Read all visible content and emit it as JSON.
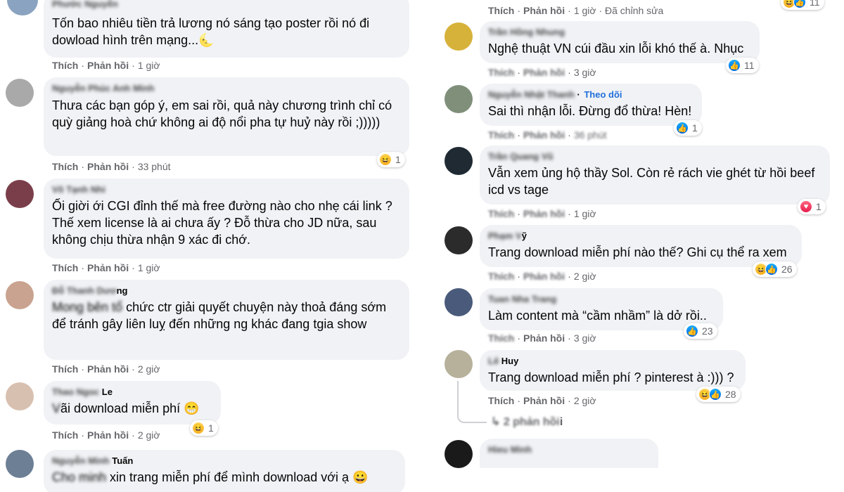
{
  "labels": {
    "like": "Thích",
    "reply": "Phản hồi"
  },
  "left": [
    {
      "id": "c1",
      "avatar_color": "#8aa3c0",
      "author_blur": "Phước Nguyễn",
      "author_clear": "",
      "text_blur": "",
      "text": "Tốn bao nhiêu tiền trả lương nó sáng tạo poster rồi nó đi dowload hình trên mạng...",
      "emoji": "🌜",
      "time": "1 giờ",
      "reaction": null
    },
    {
      "id": "c2",
      "avatar_color": "#a9a9a9",
      "author_blur": "Nguyễn Phúc Anh Minh",
      "author_clear": "",
      "text_blur": "",
      "text": "Thưa các bạn góp ý, em sai rồi, quả này chương trình chỉ có quỳ giảng hoà chứ không ai độ nổi pha tự huỷ này rồi ;)))))",
      "emoji": "",
      "time": "33 phút",
      "reaction": {
        "icons": [
          "haha"
        ],
        "count": "1"
      }
    },
    {
      "id": "c3",
      "avatar_color": "#7a3e4a",
      "author_blur": "Võ Tạnh Nhi",
      "author_clear": "",
      "text_blur": "",
      "text": "Ối giời ới CGI đỉnh thế mà free đường nào cho nhẹ cái link ? Thế xem license là ai chưa ấy ? Đỗ thừa cho JD nữa, sau không chịu thừa nhận 9 xác đi chớ.",
      "emoji": "",
      "time": "1 giờ",
      "reaction": null
    },
    {
      "id": "c4",
      "avatar_color": "#c9a38f",
      "author_blur": "Đỗ Thanh Dươ",
      "author_clear": "ng",
      "text_blur": "Mong bên tổ",
      "text": " chức ctr giải quyết chuyện này thoả đáng sớm để tránh gây liên luỵ đến những ng khác đang tgia show",
      "emoji": "",
      "time": "2 giờ",
      "reaction": null
    },
    {
      "id": "c5",
      "avatar_color": "#d8c0b0",
      "author_blur": "Thao Ngoc",
      "author_clear": " Le",
      "text_blur": "V",
      "text": "ãi download miễn phí",
      "emoji": "😁",
      "time": "2 giờ",
      "reaction": {
        "icons": [
          "haha"
        ],
        "count": "1"
      }
    },
    {
      "id": "c6",
      "avatar_color": "#6d7f95",
      "author_blur": "Nguyễn Minh ",
      "author_clear": "Tuấn",
      "text_blur": "Cho minh",
      "text": " xin trang miễn phí để mình download với ạ",
      "emoji": "😀",
      "time": "",
      "reaction": null
    }
  ],
  "right": [
    {
      "id": "r0",
      "show_avatar": false,
      "avatar_color": "#cccccc",
      "author_blur": "",
      "author_clear": "",
      "follow": "",
      "text": "",
      "time": "1 giờ · Đã chỉnh sửa",
      "actions_blur": false,
      "reaction": {
        "icons": [
          "haha",
          "like"
        ],
        "count": "11"
      }
    },
    {
      "id": "r1",
      "show_avatar": true,
      "avatar_color": "#d6b23a",
      "author_blur": "Trần Hồng Nhung",
      "author_clear": "",
      "follow": "",
      "text": "Nghệ thuật VN cúi đầu xin lỗi khó thế à. Nhục",
      "time": "3 giờ",
      "actions_blur": true,
      "reaction": {
        "icons": [
          "like"
        ],
        "count": "11"
      }
    },
    {
      "id": "r2",
      "show_avatar": true,
      "avatar_color": "#7f8f7a",
      "author_blur": "Nguyễn Nhật Thanh",
      "author_clear": "",
      "follow": "Theo dõi",
      "text": "Sai thì nhận lỗi. Đừng đổ thừa! Hèn!",
      "time": "36 phút",
      "actions_blur": true,
      "reaction": {
        "icons": [
          "like"
        ],
        "count": "1"
      }
    },
    {
      "id": "r3",
      "show_avatar": true,
      "avatar_color": "#1f2a33",
      "author_blur": "Trần Quang Vũ",
      "author_clear": "",
      "follow": "",
      "text": "Vẫn xem ủng hộ thầy Sol. Còn rẻ rách vie ghét từ hồi beef icd vs tage",
      "time": "1 giờ",
      "actions_blur": true,
      "reaction": {
        "icons": [
          "love"
        ],
        "count": "1"
      }
    },
    {
      "id": "r4",
      "show_avatar": true,
      "avatar_color": "#2b2b2b",
      "author_blur": "Phạm V",
      "author_clear": "ỹ",
      "follow": "",
      "text": "Trang download miễn phí nào thế? Ghi cụ thể ra xem",
      "time": "2 giờ",
      "actions_blur": true,
      "reaction": {
        "icons": [
          "haha",
          "like"
        ],
        "count": "26"
      }
    },
    {
      "id": "r5",
      "show_avatar": true,
      "avatar_color": "#4a5a7a",
      "author_blur": "Tuan Nha Trang",
      "author_clear": "",
      "follow": "",
      "text": "Làm content mà “cầm nhầm” là dở rồi..",
      "time": "3 giờ",
      "actions_blur": true,
      "reaction": {
        "icons": [
          "like"
        ],
        "count": "23"
      }
    },
    {
      "id": "r6",
      "show_avatar": true,
      "avatar_color": "#b7b09a",
      "author_blur": "Lê",
      "author_clear": " Huy",
      "follow": "",
      "text": "Trang download miễn phí ? pinterest à :))) ?",
      "time": "2 giờ",
      "actions_blur": false,
      "reaction": {
        "icons": [
          "haha",
          "like"
        ],
        "count": "28"
      }
    },
    {
      "id": "r7",
      "show_avatar": true,
      "avatar_color": "#1a1a1a",
      "author_blur": "Hieu Minh",
      "author_clear": "",
      "follow": "",
      "text": "",
      "time": "",
      "actions_blur": false,
      "reaction": null
    }
  ],
  "replies": {
    "arrow": "↳",
    "text": "2 phản hồi"
  }
}
